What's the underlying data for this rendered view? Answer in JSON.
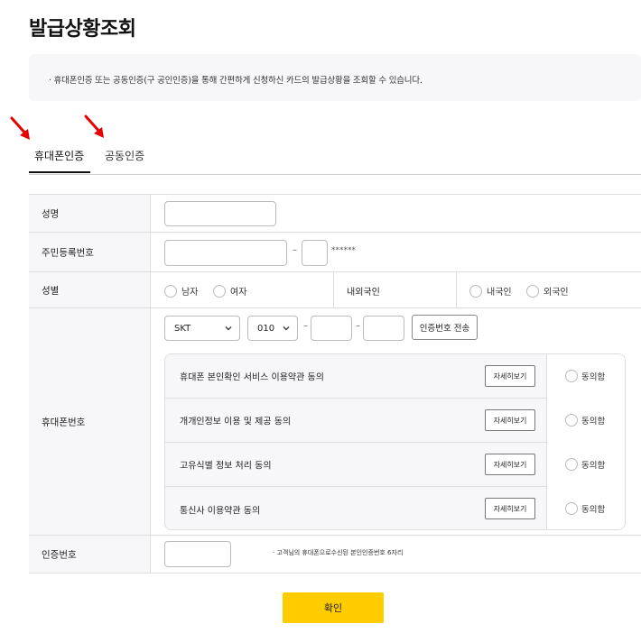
{
  "page": {
    "title": "발급상황조회",
    "notice": "· 휴대폰인증 또는 공동인증(구 공인인증)을 통해 간편하게 신청하신 카드의 발급상황을 조회할 수 있습니다."
  },
  "tabs": [
    {
      "label": "휴대폰인증",
      "active": true
    },
    {
      "label": "공동인증",
      "active": false
    }
  ],
  "annotation_color": "#e60000",
  "form": {
    "name": {
      "label": "성명",
      "value": ""
    },
    "rrn": {
      "label": "주민등록번호",
      "front": "",
      "back": "",
      "masked": "******"
    },
    "gender": {
      "label": "성별",
      "options": [
        "남자",
        "여자"
      ],
      "nationality_label": "내외국인",
      "nationality_options": [
        "내국인",
        "외국인"
      ]
    },
    "phone": {
      "label": "휴대폰번호",
      "carrier": "SKT",
      "prefix": "010",
      "middle": "",
      "last": "",
      "send_button": "인증번호 전송",
      "consents": [
        {
          "text": "휴대폰 본인확인 서비스 이용약관 동의",
          "detail": "자세히보기",
          "agree": "동의함"
        },
        {
          "text": "개개인정보 이용 및 제공 동의",
          "detail": "자세히보기",
          "agree": "동의함"
        },
        {
          "text": "고유식별 정보 처리 동의",
          "detail": "자세히보기",
          "agree": "동의함"
        },
        {
          "text": "통신사 이용약관 동의",
          "detail": "자세히보기",
          "agree": "동의함"
        }
      ]
    },
    "auth": {
      "label": "인증번호",
      "value": "",
      "hint": "· 고객님의 휴대폰으로수신된 본인인증번호 6자리"
    }
  },
  "confirm_button": "확인",
  "colors": {
    "accent": "#ffcc00",
    "label_bg": "#f7f7f9",
    "border": "#dddddd"
  }
}
